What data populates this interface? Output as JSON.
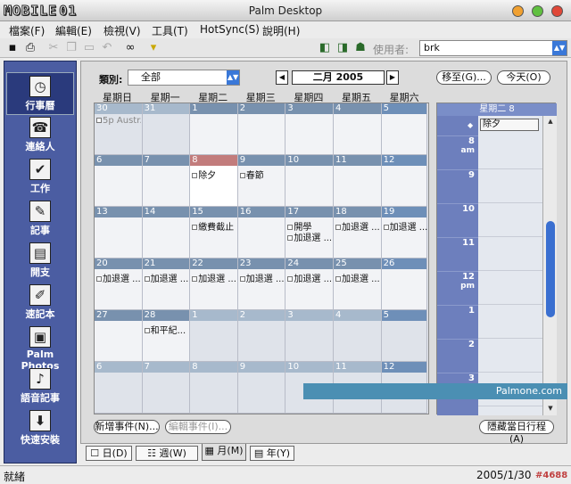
{
  "window": {
    "title": "Palm Desktop",
    "logo": "MOBILE",
    "badge": "01"
  },
  "menu": [
    "檔案(F)",
    "編輯(E)",
    "檢視(V)",
    "工具(T)",
    "HotSync(S)",
    "說明(H)"
  ],
  "toolbar": {
    "user_label": "使用者:",
    "user_value": "brk"
  },
  "sidebar": [
    {
      "label": "行事曆",
      "icon": "calendar-clock-icon",
      "glyph": "◷",
      "selected": true
    },
    {
      "label": "連絡人",
      "icon": "address-book-icon",
      "glyph": "☎",
      "selected": false
    },
    {
      "label": "工作",
      "icon": "checklist-icon",
      "glyph": "✔",
      "selected": false
    },
    {
      "label": "記事",
      "icon": "notepad-icon",
      "glyph": "✎",
      "selected": false
    },
    {
      "label": "開支",
      "icon": "expense-icon",
      "glyph": "▤",
      "selected": false
    },
    {
      "label": "速記本",
      "icon": "sketchpad-icon",
      "glyph": "✐",
      "selected": false
    },
    {
      "label": "Palm Photos",
      "icon": "photo-icon",
      "glyph": "▣",
      "selected": false
    },
    {
      "label": "語音記事",
      "icon": "microphone-icon",
      "glyph": "♪",
      "selected": false
    },
    {
      "label": "快速安裝",
      "icon": "install-icon",
      "glyph": "⬇",
      "selected": false
    }
  ],
  "calendar": {
    "category_label": "類別:",
    "category_value": "全部",
    "month_label": "二月 2005",
    "goto_label": "移至(G)...",
    "today_label": "今天(O)",
    "weekdays": [
      "星期日",
      "星期一",
      "星期二",
      "星期三",
      "星期四",
      "星期五",
      "星期六"
    ],
    "weeks": [
      [
        {
          "n": "30",
          "o": true,
          "e": [
            "5p Austr..."
          ]
        },
        {
          "n": "31",
          "o": true,
          "e": []
        },
        {
          "n": "1",
          "e": []
        },
        {
          "n": "2",
          "e": []
        },
        {
          "n": "3",
          "e": []
        },
        {
          "n": "4",
          "e": []
        },
        {
          "n": "5",
          "e": []
        }
      ],
      [
        {
          "n": "6",
          "e": []
        },
        {
          "n": "7",
          "e": []
        },
        {
          "n": "8",
          "t": true,
          "e": [
            "除夕"
          ]
        },
        {
          "n": "9",
          "e": [
            "春節"
          ]
        },
        {
          "n": "10",
          "e": []
        },
        {
          "n": "11",
          "e": []
        },
        {
          "n": "12",
          "e": []
        }
      ],
      [
        {
          "n": "13",
          "e": []
        },
        {
          "n": "14",
          "e": []
        },
        {
          "n": "15",
          "e": [
            "繳費截止"
          ]
        },
        {
          "n": "16",
          "e": []
        },
        {
          "n": "17",
          "e": [
            "開學",
            "加退選 ..."
          ]
        },
        {
          "n": "18",
          "e": [
            "加退選 ..."
          ]
        },
        {
          "n": "19",
          "e": [
            "加退選 ..."
          ]
        }
      ],
      [
        {
          "n": "20",
          "e": [
            "加退選 ..."
          ]
        },
        {
          "n": "21",
          "e": [
            "加退選 ..."
          ]
        },
        {
          "n": "22",
          "e": [
            "加退選 ..."
          ]
        },
        {
          "n": "23",
          "e": [
            "加退選 ..."
          ]
        },
        {
          "n": "24",
          "e": [
            "加退選 ..."
          ]
        },
        {
          "n": "25",
          "e": [
            "加退選 ..."
          ]
        },
        {
          "n": "26",
          "e": []
        }
      ],
      [
        {
          "n": "27",
          "e": []
        },
        {
          "n": "28",
          "e": [
            "和平紀..."
          ]
        },
        {
          "n": "1",
          "o": true,
          "e": []
        },
        {
          "n": "2",
          "o": true,
          "e": []
        },
        {
          "n": "3",
          "o": true,
          "e": []
        },
        {
          "n": "4",
          "o": true,
          "e": []
        },
        {
          "n": "5",
          "o": true,
          "e": []
        }
      ],
      [
        {
          "n": "6",
          "o": true,
          "e": []
        },
        {
          "n": "7",
          "o": true,
          "e": []
        },
        {
          "n": "8",
          "o": true,
          "e": []
        },
        {
          "n": "9",
          "o": true,
          "e": []
        },
        {
          "n": "10",
          "o": true,
          "e": []
        },
        {
          "n": "11",
          "o": true,
          "e": []
        },
        {
          "n": "12",
          "o": true,
          "e": []
        }
      ]
    ]
  },
  "day": {
    "header": "星期二 8",
    "all_day_event": "除夕",
    "hours": [
      {
        "h": "8",
        "ampm": "am"
      },
      {
        "h": "9",
        "ampm": ""
      },
      {
        "h": "10",
        "ampm": ""
      },
      {
        "h": "11",
        "ampm": ""
      },
      {
        "h": "12",
        "ampm": "pm"
      },
      {
        "h": "1",
        "ampm": ""
      },
      {
        "h": "2",
        "ampm": ""
      },
      {
        "h": "3",
        "ampm": ""
      }
    ],
    "hide_label": "隱藏當日行程(A)"
  },
  "buttons": {
    "new_event": "新增事件(N)...",
    "edit_event": "編輯事件(I)..."
  },
  "brand": "Palmone.com",
  "view_tabs": [
    {
      "label": "日(D)",
      "selected": false
    },
    {
      "label": "週(W)",
      "selected": false
    },
    {
      "label": "月(M)",
      "selected": true
    },
    {
      "label": "年(Y)",
      "selected": false
    }
  ],
  "status": {
    "left": "就緒",
    "date": "2005/1/30",
    "tag": "#4688"
  },
  "colors": {
    "sidebar": "#4b5da2",
    "week_header": "#7891ae",
    "today_header": "#c27c7c",
    "hour_col": "#6d7fbd",
    "scroll_thumb": "#3a6fd0"
  }
}
